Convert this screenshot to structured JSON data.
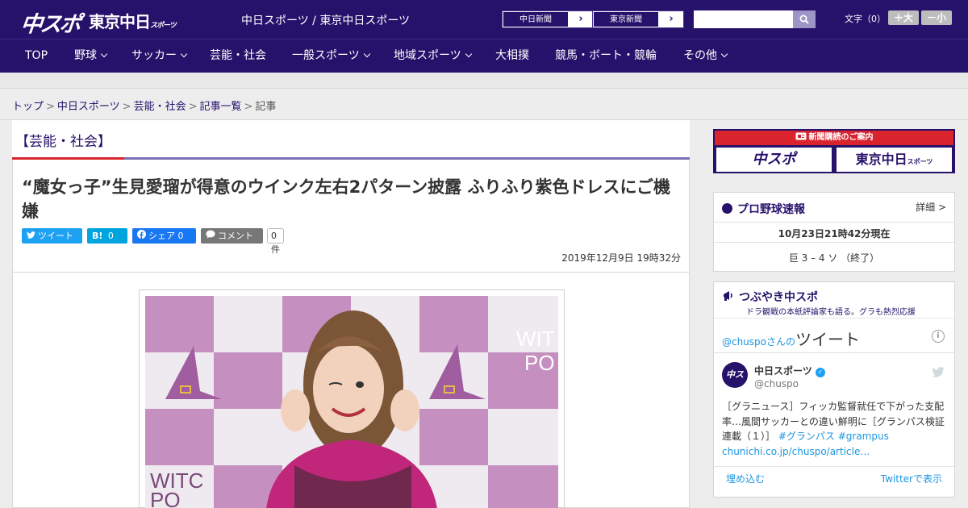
{
  "header": {
    "logo_main": "中スポ",
    "logo_tokyo": "東京中日",
    "logo_tokyo_sub": "スポーツ",
    "site_title": "中日スポーツ / 東京中日スポーツ",
    "links": [
      {
        "label": "中日新聞",
        "arrow": "›"
      },
      {
        "label": "東京新聞",
        "arrow": "›"
      }
    ],
    "search": {
      "placeholder": ""
    },
    "font_size_label": "文字（0）",
    "font_bigger": "＋大",
    "font_smaller": "－小"
  },
  "nav": {
    "items": [
      {
        "label": "TOP"
      },
      {
        "label": "野球"
      },
      {
        "label": "サッカー"
      },
      {
        "label": "芸能・社会"
      },
      {
        "label": "一般スポーツ"
      },
      {
        "label": "地域スポーツ"
      },
      {
        "label": "大相撲"
      },
      {
        "label": "競馬・ボート・競輪"
      },
      {
        "label": "その他"
      }
    ]
  },
  "breadcrumb": {
    "items": [
      "トップ",
      "中日スポーツ",
      "芸能・社会",
      "記事一覧"
    ],
    "current": "記事",
    "separator": ">"
  },
  "article": {
    "category": "【芸能・社会】",
    "title": "“魔女っ子”生見愛瑠が得意のウインク左右2パターン披露 ふりふり紫色ドレスにご機嫌",
    "share": {
      "tweet": "ツイート",
      "hatena_icon": "B!",
      "hatena_count": "0",
      "facebook": "シェア 0",
      "comment": "コメント",
      "comment_count": "0件"
    },
    "date": "2019年12月9日 19時32分",
    "photo_text_left": "WITC",
    "photo_text_left2": "PO",
    "photo_text_right": "WIT",
    "photo_text_right2": "PO"
  },
  "sidebar": {
    "subscribe_banner": "新聞購読のご案内",
    "sub_logo1": "中スポ",
    "sub_logo2": "東京中日",
    "sub_logo2_small": "スポーツ",
    "baseball": {
      "title": "プロ野球速報",
      "detail": "詳細 >",
      "time": "10月23日21時42分現在",
      "score": "巨 3 – 4 ソ （終了）"
    },
    "twitter": {
      "title": "つぶやき中スポ",
      "subtitle": "ドラ観戦の本紙評論家も語る。グラも熱烈応援",
      "head_user": "@chuspoさんの",
      "head_big": "ツイート",
      "info": "i",
      "avatar": "中ス",
      "name": "中日スポーツ",
      "handle": "@chuspo",
      "text": "［グラニュース］フィッカ監督就任で下がった支配率…風間サッカーとの違い鮮明に［グランパス検証連載（１）］",
      "hashtags": "#グランパス #grampus",
      "link": "chunichi.co.jp/chuspo/article…",
      "embed": "埋め込む",
      "view": "Twitterで表示"
    }
  },
  "colors": {
    "brand_navy": "#26116b",
    "accent_red": "#d9232d",
    "twitter_blue": "#1da1f2",
    "hatena_blue": "#00a4de",
    "facebook_blue": "#1877f2",
    "comment_gray": "#777777"
  }
}
